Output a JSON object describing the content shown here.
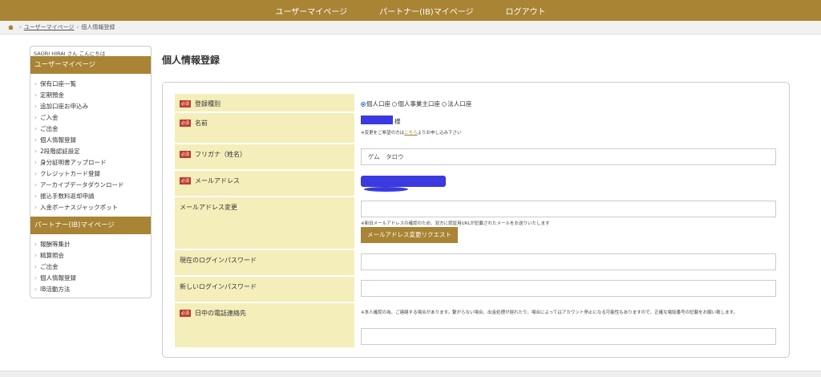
{
  "topnav": {
    "items": [
      "ユーザーマイページ",
      "パートナー(IB)マイページ",
      "ログアウト"
    ]
  },
  "breadcrumb": {
    "link": "ユーザーマイページ",
    "sep": "›",
    "current": "個人情報登録"
  },
  "sidebar": {
    "greeting": "SAORI HIRAI さん こんにちは",
    "user_heading": "ユーザーマイページ",
    "user_items": [
      "保有口座一覧",
      "定期預金",
      "追加口座お申込み",
      "ご入金",
      "ご出金",
      "個人情報登録",
      "2段階認証設定",
      "身分証明書アップロード",
      "クレジットカード登録",
      "アーカイブデータダウンロード",
      "振込手数料返却申請",
      "入金ボーナスジャックポット"
    ],
    "partner_heading": "パートナー(IB)マイページ",
    "partner_items": [
      "報酬等集計",
      "精算照会",
      "ご出金",
      "個人情報登録",
      "IB活動方法"
    ]
  },
  "page_title": "個人情報登録",
  "form": {
    "required_badge": "必須",
    "type": {
      "label": "登録種別",
      "options": [
        "個人口座",
        "個人事業主口座",
        "法人口座"
      ],
      "selected": 0
    },
    "name": {
      "label": "名前",
      "suffix": "様",
      "note_pre": "※変更をご希望の方は",
      "note_link": "こちら",
      "note_post": "よりお申し込み下さい"
    },
    "furigana": {
      "label": "フリガナ（姓名）",
      "value": "ゲム　タロウ"
    },
    "email": {
      "label": "メールアドレス"
    },
    "email_change": {
      "label": "メールアドレス変更",
      "value": "",
      "note": "※新旧メールアドレスの確認のため、双方に認証用URLが記載されたメールをお送りいたします",
      "button": "メールアドレス変更リクエスト"
    },
    "current_password": {
      "label": "現在のログインパスワード",
      "value": ""
    },
    "new_password": {
      "label": "新しいログインパスワード",
      "value": ""
    },
    "phone": {
      "label": "日中の電話連絡先",
      "note": "※本人確認の為、ご連絡する場合があります。繋がらない場合、出金処理が遅れたり、場合によってはアカウント停止になる可能性もありますので、正確な電話番号の記載をお願い致します。",
      "value": ""
    }
  },
  "colors": {
    "brand": "#a88434",
    "label_bg": "#f4eebb",
    "required": "#c0392b"
  }
}
